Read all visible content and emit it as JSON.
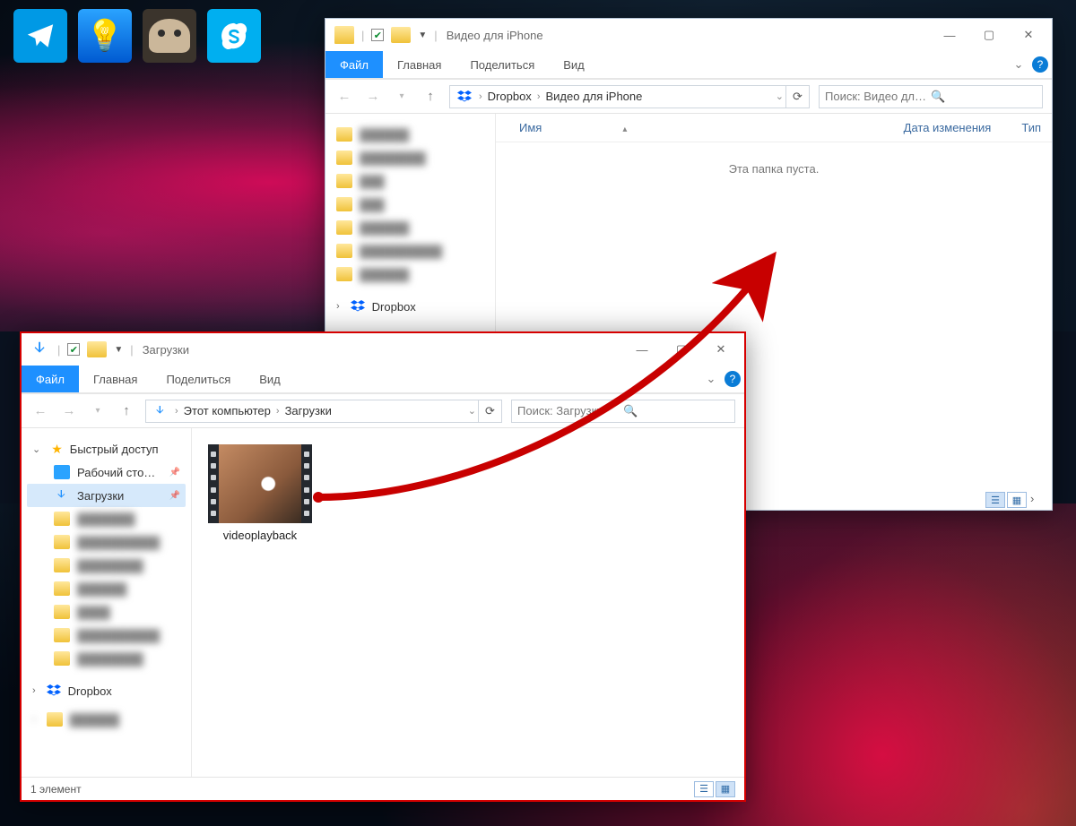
{
  "taskbar": {
    "telegram": "Telegram",
    "tips": "Tips",
    "gimp": "GIMP",
    "skype": "Skype"
  },
  "window_top": {
    "title": "Видео для iPhone",
    "tabs": {
      "file": "Файл",
      "home": "Главная",
      "share": "Поделиться",
      "view": "Вид"
    },
    "breadcrumb": {
      "root": "Dropbox",
      "leaf": "Видео для iPhone"
    },
    "search_placeholder": "Поиск: Видео для iPhone",
    "columns": {
      "name": "Имя",
      "date": "Дата изменения",
      "type": "Тип"
    },
    "empty": "Эта папка пуста.",
    "sidebar": {
      "dropbox": "Dropbox",
      "blurred_count": 7
    }
  },
  "window_bottom": {
    "title": "Загрузки",
    "tabs": {
      "file": "Файл",
      "home": "Главная",
      "share": "Поделиться",
      "view": "Вид"
    },
    "breadcrumb": {
      "root": "Этот компьютер",
      "leaf": "Загрузки"
    },
    "search_placeholder": "Поиск: Загрузки",
    "sidebar": {
      "quick_access": "Быстрый доступ",
      "desktop": "Рабочий сто…",
      "downloads": "Загрузки",
      "dropbox": "Dropbox",
      "blurred_count": 8
    },
    "file": {
      "name": "videoplayback"
    },
    "status": "1 элемент"
  }
}
